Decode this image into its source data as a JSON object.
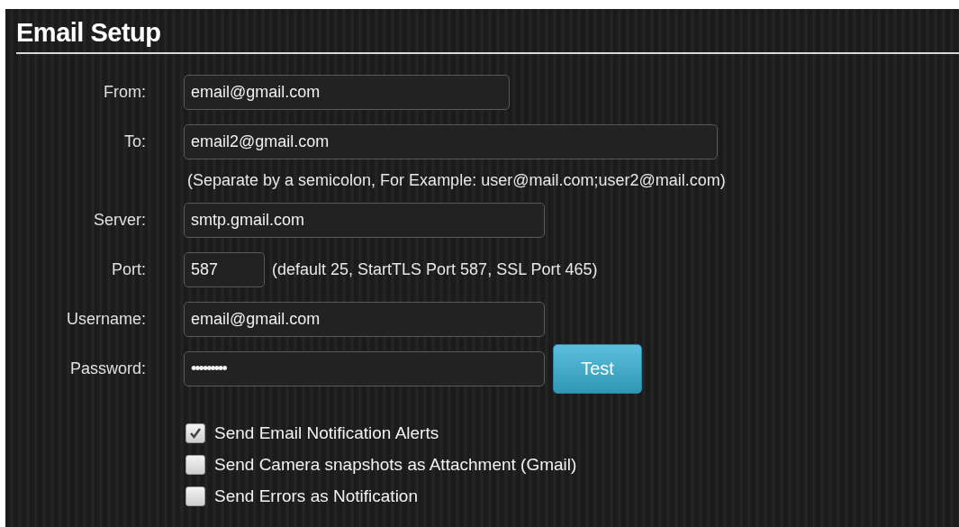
{
  "title": "Email Setup",
  "fields": [
    {
      "label": "From:",
      "value": "email@gmail.com",
      "kind": "text"
    },
    {
      "label": "To:",
      "value": "email2@gmail.com",
      "kind": "text",
      "note": "(Separate by a semicolon, For Example: user@mail.com;user2@mail.com)"
    },
    {
      "label": "Server:",
      "value": "smtp.gmail.com",
      "kind": "text"
    },
    {
      "label": "Port:",
      "value": "587",
      "kind": "text",
      "hint": "(default 25, StartTLS Port 587, SSL Port 465)"
    },
    {
      "label": "Username:",
      "value": "email@gmail.com",
      "kind": "text"
    },
    {
      "label": "Password:",
      "value": "•••••••••",
      "kind": "password",
      "button": "Test"
    }
  ],
  "options": [
    {
      "label": "Send Email Notification Alerts",
      "checked": true
    },
    {
      "label": "Send Camera snapshots as Attachment (Gmail)",
      "checked": false
    },
    {
      "label": "Send Errors as Notification",
      "checked": false
    }
  ]
}
